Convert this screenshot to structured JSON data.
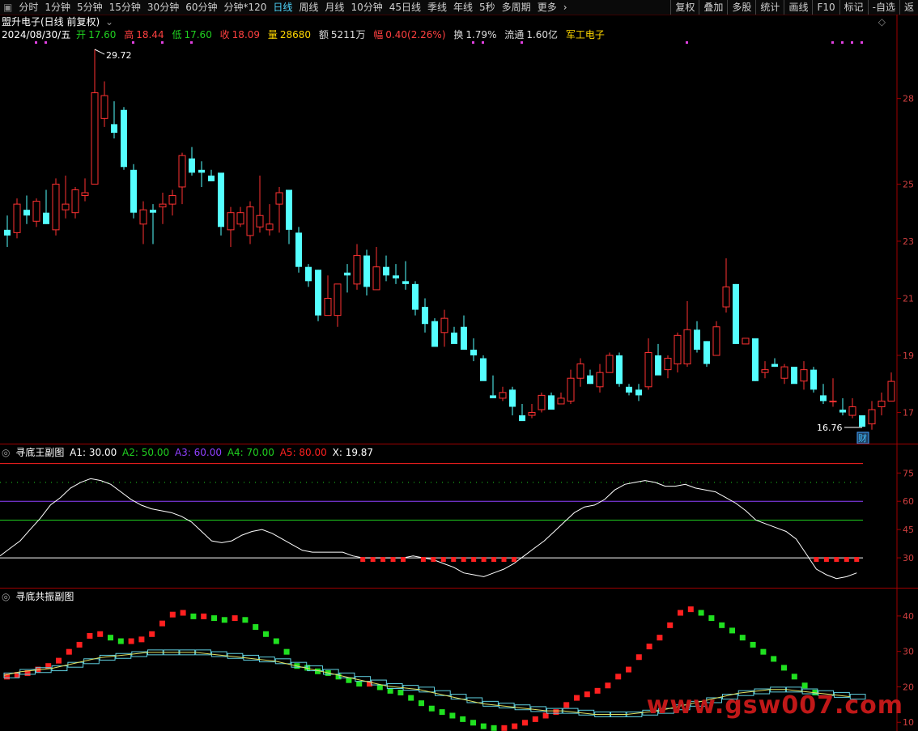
{
  "toolbar": {
    "items": [
      "分时",
      "1分钟",
      "5分钟",
      "15分钟",
      "30分钟",
      "60分钟",
      "分钟*120",
      "日线",
      "周线",
      "月线",
      "10分钟",
      "45日线",
      "季线",
      "年线",
      "5秒",
      "多周期",
      "更多"
    ],
    "active": "日线",
    "right_items": [
      "复权",
      "叠加",
      "多股",
      "统计",
      "画线",
      "F10",
      "标记",
      "-自选",
      "返"
    ]
  },
  "quote": {
    "stock": "盟升电子(日线 前复权)",
    "date": "2024/08/30/五",
    "open_label": "开",
    "open": "17.60",
    "high_label": "高",
    "high": "18.44",
    "low_label": "低",
    "low": "17.60",
    "close_label": "收",
    "close": "18.09",
    "vol_label": "量",
    "vol": "28680",
    "amount_label": "额",
    "amount": "5211万",
    "change_label": "幅",
    "change": "0.40(2.26%)",
    "turnover_label": "换",
    "turnover": "1.79%",
    "float_label": "流通",
    "float": "1.60亿",
    "sector": "军工电子"
  },
  "main_chart": {
    "high_marker": "29.72",
    "low_marker": "16.76",
    "badge": "财",
    "y_ticks": [
      "28",
      "25",
      "23",
      "21",
      "19",
      "17"
    ],
    "colors": {
      "up": "#ff3232",
      "down": "#54ffff",
      "bg": "#000000"
    }
  },
  "indicator1": {
    "name": "寻底王副图",
    "a1_label": "A1: 30.00",
    "a2_label": "A2: 50.00",
    "a3_label": "A3: 60.00",
    "a4_label": "A4: 70.00",
    "a5_label": "A5: 80.00",
    "x_label": "X: 19.87",
    "y_ticks": [
      "75",
      "60",
      "45",
      "30"
    ],
    "colors": {
      "a1": "#ffffff",
      "a2": "#20d020",
      "a3": "#9040ff",
      "a4": "#20d020",
      "a5": "#ff2020",
      "x": "#ffffff"
    }
  },
  "indicator2": {
    "name": "寻底共振副图",
    "y_ticks": [
      "40",
      "30",
      "20",
      "10"
    ]
  },
  "watermark": "www.gsw007.com",
  "chart_data": {
    "type": "candlestick",
    "candles": [
      [
        23.4,
        23.9,
        22.8,
        23.2
      ],
      [
        23.3,
        24.5,
        23.1,
        24.3
      ],
      [
        24.1,
        24.6,
        23.6,
        23.9
      ],
      [
        23.7,
        24.5,
        23.5,
        24.4
      ],
      [
        24.0,
        24.8,
        23.6,
        23.6
      ],
      [
        23.4,
        25.2,
        23.2,
        25.0
      ],
      [
        24.1,
        25.3,
        23.8,
        24.3
      ],
      [
        24.0,
        24.9,
        23.8,
        24.8
      ],
      [
        24.6,
        25.2,
        24.4,
        24.7
      ],
      [
        25.0,
        29.72,
        25.0,
        28.2
      ],
      [
        27.3,
        28.6,
        27.0,
        28.1
      ],
      [
        27.1,
        27.9,
        26.6,
        26.8
      ],
      [
        27.6,
        27.7,
        25.5,
        25.6
      ],
      [
        25.5,
        25.7,
        23.8,
        24.0
      ],
      [
        23.6,
        24.4,
        22.9,
        24.1
      ],
      [
        24.1,
        24.3,
        22.9,
        24.0
      ],
      [
        24.2,
        24.7,
        23.6,
        24.3
      ],
      [
        24.3,
        24.8,
        23.9,
        24.6
      ],
      [
        24.9,
        26.1,
        24.3,
        26.0
      ],
      [
        25.9,
        26.3,
        25.3,
        25.4
      ],
      [
        25.5,
        25.8,
        24.9,
        25.4
      ],
      [
        25.3,
        25.5,
        25.2,
        25.1
      ],
      [
        25.4,
        25.3,
        23.2,
        23.5
      ],
      [
        23.4,
        24.2,
        22.8,
        24.0
      ],
      [
        23.6,
        24.2,
        23.5,
        24.0
      ],
      [
        23.2,
        24.4,
        22.9,
        24.2
      ],
      [
        23.5,
        25.3,
        23.3,
        23.9
      ],
      [
        23.4,
        24.3,
        23.2,
        23.6
      ],
      [
        24.3,
        24.9,
        23.3,
        24.7
      ],
      [
        24.8,
        24.8,
        22.9,
        23.4
      ],
      [
        23.3,
        23.5,
        21.9,
        22.1
      ],
      [
        22.1,
        22.2,
        21.4,
        21.6
      ],
      [
        22.0,
        22.0,
        20.2,
        20.4
      ],
      [
        20.4,
        21.8,
        20.5,
        21.0
      ],
      [
        20.4,
        21.3,
        20.0,
        21.5
      ],
      [
        21.9,
        22.2,
        21.2,
        21.8
      ],
      [
        21.5,
        22.9,
        21.3,
        22.5
      ],
      [
        22.5,
        22.7,
        21.1,
        21.4
      ],
      [
        21.3,
        22.8,
        21.6,
        22.1
      ],
      [
        22.1,
        22.5,
        21.6,
        21.8
      ],
      [
        21.8,
        22.2,
        21.5,
        21.7
      ],
      [
        21.6,
        22.3,
        21.3,
        21.5
      ],
      [
        21.5,
        21.6,
        20.4,
        20.6
      ],
      [
        20.7,
        21.0,
        19.8,
        20.1
      ],
      [
        20.2,
        20.3,
        19.7,
        19.3
      ],
      [
        19.8,
        20.6,
        19.3,
        20.3
      ],
      [
        19.8,
        20.0,
        19.5,
        19.4
      ],
      [
        20.0,
        20.4,
        19.2,
        19.2
      ],
      [
        19.2,
        19.6,
        18.8,
        19.0
      ],
      [
        18.9,
        19.0,
        18.2,
        18.1
      ],
      [
        17.6,
        18.3,
        17.6,
        17.5
      ],
      [
        17.5,
        17.9,
        17.4,
        17.7
      ],
      [
        17.8,
        17.9,
        16.9,
        17.2
      ],
      [
        16.9,
        17.3,
        16.9,
        16.7
      ],
      [
        16.9,
        17.3,
        16.8,
        17.0
      ],
      [
        17.1,
        17.7,
        17.0,
        17.6
      ],
      [
        17.6,
        17.7,
        17.2,
        17.1
      ],
      [
        17.3,
        17.7,
        17.3,
        17.5
      ],
      [
        17.4,
        18.5,
        17.3,
        18.2
      ],
      [
        18.2,
        18.9,
        17.9,
        18.7
      ],
      [
        18.3,
        18.5,
        18.0,
        18.0
      ],
      [
        17.9,
        18.7,
        17.7,
        18.4
      ],
      [
        18.4,
        19.1,
        18.4,
        19.0
      ],
      [
        19.0,
        19.1,
        17.9,
        18.0
      ],
      [
        17.9,
        18.0,
        17.6,
        17.7
      ],
      [
        17.8,
        18.0,
        17.4,
        17.6
      ],
      [
        17.9,
        19.6,
        17.8,
        19.1
      ],
      [
        19.0,
        19.4,
        18.4,
        18.3
      ],
      [
        18.5,
        19.0,
        18.2,
        18.9
      ],
      [
        18.7,
        19.8,
        18.4,
        19.7
      ],
      [
        18.7,
        20.9,
        18.6,
        19.9
      ],
      [
        19.9,
        20.2,
        19.1,
        19.2
      ],
      [
        19.5,
        19.5,
        18.6,
        18.7
      ],
      [
        19.0,
        20.2,
        19.0,
        20.0
      ],
      [
        20.7,
        22.4,
        20.5,
        21.4
      ],
      [
        21.5,
        21.5,
        19.4,
        19.4
      ],
      [
        19.4,
        19.5,
        19.4,
        19.6
      ],
      [
        19.6,
        19.3,
        18.1,
        18.1
      ],
      [
        18.4,
        18.8,
        18.2,
        18.5
      ],
      [
        18.7,
        18.9,
        18.6,
        18.6
      ],
      [
        18.2,
        18.7,
        18.0,
        18.6
      ],
      [
        18.6,
        18.5,
        18.1,
        18.0
      ],
      [
        18.1,
        18.8,
        17.8,
        18.5
      ],
      [
        18.5,
        18.6,
        17.7,
        17.8
      ],
      [
        17.6,
        18.0,
        17.3,
        17.4
      ],
      [
        17.4,
        18.2,
        17.2,
        17.4
      ],
      [
        17.1,
        17.5,
        16.9,
        17.0
      ],
      [
        16.9,
        17.5,
        16.8,
        17.2
      ],
      [
        16.9,
        16.9,
        16.5,
        16.5
      ],
      [
        16.6,
        17.4,
        16.4,
        17.1
      ],
      [
        17.2,
        17.7,
        16.9,
        17.4
      ],
      [
        17.4,
        18.4,
        17.6,
        18.09
      ]
    ],
    "indicator1_x": [
      31,
      35,
      39,
      45,
      51,
      58,
      62,
      67,
      70,
      72,
      71,
      69,
      65,
      61,
      58,
      56,
      55,
      54,
      52,
      49,
      44,
      39,
      38,
      39,
      42,
      44,
      45,
      43,
      40,
      37,
      34,
      33,
      33,
      33,
      33,
      31,
      30,
      30,
      30,
      30,
      30,
      31,
      30,
      29,
      27,
      25,
      22,
      21,
      20,
      22,
      24,
      27,
      31,
      35,
      39,
      44,
      49,
      54,
      57,
      58,
      61,
      66,
      69,
      70,
      71,
      70,
      68,
      68,
      69,
      67,
      66,
      65,
      62,
      59,
      55,
      50,
      48,
      46,
      44,
      40,
      32,
      24,
      21,
      19,
      20,
      22
    ]
  }
}
